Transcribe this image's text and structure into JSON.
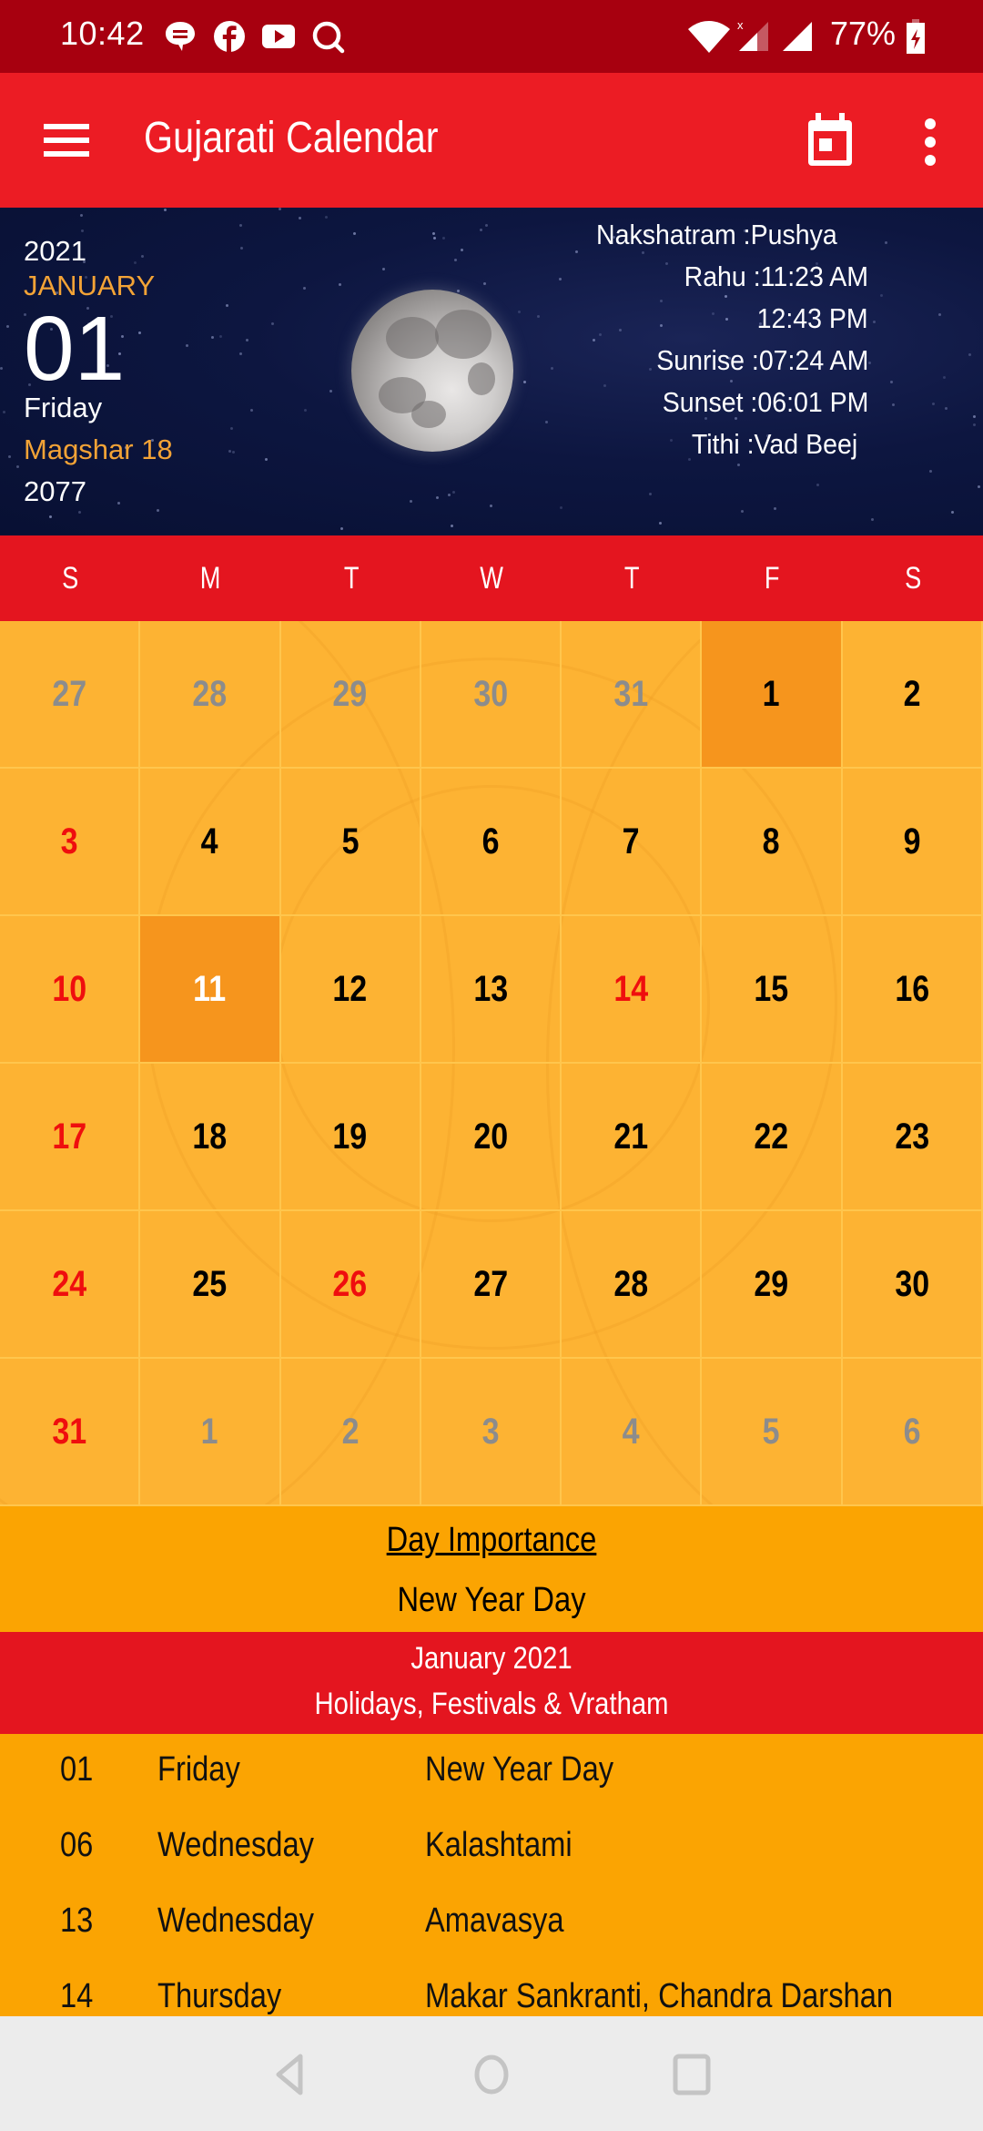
{
  "status_bar": {
    "time": "10:42",
    "notification_icons": [
      "chat-icon",
      "facebook-icon",
      "youtube-icon",
      "search-app-icon"
    ],
    "system_icons": [
      "wifi-icon",
      "signal-no-data-icon",
      "signal-icon",
      "battery-charging-icon"
    ],
    "battery": "77%"
  },
  "app_bar": {
    "title": "Gujarati Calendar",
    "menu_icon": "hamburger-menu-icon",
    "actions": [
      "calendar-today-icon",
      "more-vert-icon"
    ]
  },
  "header": {
    "year": "2021",
    "month": "JANUARY",
    "day": "01",
    "weekday": "Friday",
    "gujarati_month_day": "Magshar 18",
    "gujarati_year": "2077",
    "moon_phase_icon": "moon-icon",
    "info": [
      {
        "label": "Nakshatram :",
        "value": "Pushya"
      },
      {
        "label": "Rahu :",
        "value": "11:23 AM"
      },
      {
        "label": "",
        "value": "12:43 PM"
      },
      {
        "label": "Sunrise :",
        "value": "07:24 AM"
      },
      {
        "label": "Sunset :",
        "value": "06:01 PM"
      },
      {
        "label": "Tithi :",
        "value": "Vad Beej"
      }
    ]
  },
  "calendar": {
    "weekdays": [
      "S",
      "M",
      "T",
      "W",
      "T",
      "F",
      "S"
    ],
    "selected_day": "1",
    "today": "11",
    "colors": {
      "grid_bg": "#fdb333",
      "highlight": "#f6951d",
      "holiday": "#ef0e0e",
      "other_month": "#8c8c8c"
    },
    "cells": [
      {
        "d": "27",
        "t": "other"
      },
      {
        "d": "28",
        "t": "other"
      },
      {
        "d": "29",
        "t": "other"
      },
      {
        "d": "30",
        "t": "other"
      },
      {
        "d": "31",
        "t": "other"
      },
      {
        "d": "1",
        "t": "selected"
      },
      {
        "d": "2",
        "t": "normal"
      },
      {
        "d": "3",
        "t": "holiday"
      },
      {
        "d": "4",
        "t": "normal"
      },
      {
        "d": "5",
        "t": "normal"
      },
      {
        "d": "6",
        "t": "normal"
      },
      {
        "d": "7",
        "t": "normal"
      },
      {
        "d": "8",
        "t": "normal"
      },
      {
        "d": "9",
        "t": "normal"
      },
      {
        "d": "10",
        "t": "holiday"
      },
      {
        "d": "11",
        "t": "today"
      },
      {
        "d": "12",
        "t": "normal"
      },
      {
        "d": "13",
        "t": "normal"
      },
      {
        "d": "14",
        "t": "holiday"
      },
      {
        "d": "15",
        "t": "normal"
      },
      {
        "d": "16",
        "t": "normal"
      },
      {
        "d": "17",
        "t": "holiday"
      },
      {
        "d": "18",
        "t": "normal"
      },
      {
        "d": "19",
        "t": "normal"
      },
      {
        "d": "20",
        "t": "normal"
      },
      {
        "d": "21",
        "t": "normal"
      },
      {
        "d": "22",
        "t": "normal"
      },
      {
        "d": "23",
        "t": "normal"
      },
      {
        "d": "24",
        "t": "holiday"
      },
      {
        "d": "25",
        "t": "normal"
      },
      {
        "d": "26",
        "t": "holiday"
      },
      {
        "d": "27",
        "t": "normal"
      },
      {
        "d": "28",
        "t": "normal"
      },
      {
        "d": "29",
        "t": "normal"
      },
      {
        "d": "30",
        "t": "normal"
      },
      {
        "d": "31",
        "t": "holiday"
      },
      {
        "d": "1",
        "t": "other"
      },
      {
        "d": "2",
        "t": "other"
      },
      {
        "d": "3",
        "t": "other"
      },
      {
        "d": "4",
        "t": "other"
      },
      {
        "d": "5",
        "t": "other"
      },
      {
        "d": "6",
        "t": "other"
      }
    ]
  },
  "day_importance": {
    "title": "Day Importance",
    "value": "New Year Day"
  },
  "holidays": {
    "banner_line1": "January 2021",
    "banner_line2": "Holidays, Festivals & Vratham",
    "rows": [
      {
        "date": "01",
        "weekday": "Friday",
        "event": "New Year Day"
      },
      {
        "date": "06",
        "weekday": "Wednesday",
        "event": "Kalashtami"
      },
      {
        "date": "13",
        "weekday": "Wednesday",
        "event": "Amavasya"
      },
      {
        "date": "14",
        "weekday": "Thursday",
        "event": "Makar Sankranti, Chandra Darshan"
      }
    ]
  },
  "nav_bar": {
    "buttons": [
      "back-icon",
      "home-icon",
      "recents-icon"
    ]
  }
}
